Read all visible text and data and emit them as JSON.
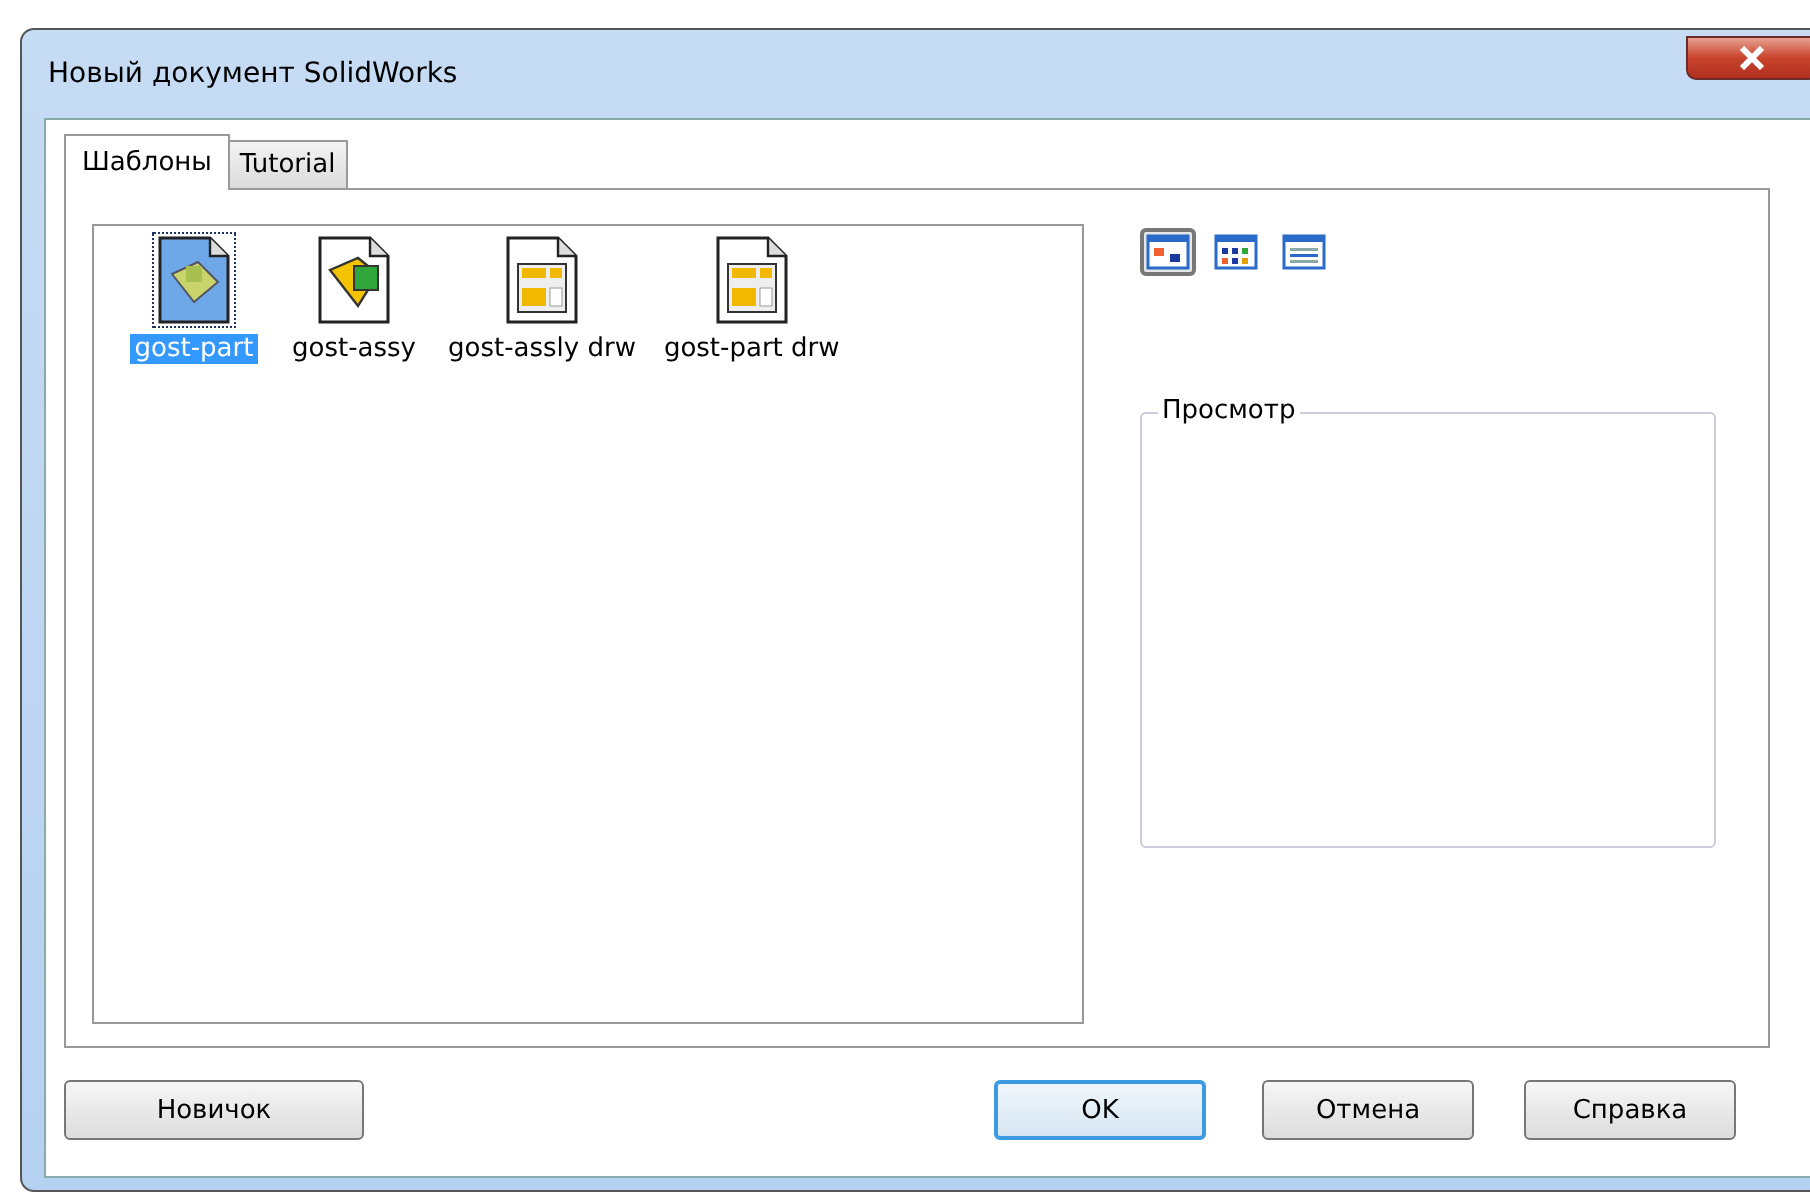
{
  "window": {
    "title": "Новый документ SolidWorks"
  },
  "tabs": [
    {
      "label": "Шаблоны",
      "selected": true
    },
    {
      "label": "Tutorial",
      "selected": false
    }
  ],
  "templates": [
    {
      "name": "gost-part",
      "kind": "part",
      "selected": true
    },
    {
      "name": "gost-assy",
      "kind": "assembly",
      "selected": false
    },
    {
      "name": "gost-assly drw",
      "kind": "drawing",
      "selected": false
    },
    {
      "name": "gost-part drw",
      "kind": "drawing",
      "selected": false
    }
  ],
  "view_modes": [
    {
      "kind": "large",
      "selected": true
    },
    {
      "kind": "list",
      "selected": false
    },
    {
      "kind": "details",
      "selected": false
    }
  ],
  "preview": {
    "label": "Просмотр"
  },
  "buttons": [
    {
      "label": "Новичок",
      "default": false
    },
    {
      "label": "OK",
      "default": true
    },
    {
      "label": "Отмена",
      "default": false
    },
    {
      "label": "Справка",
      "default": false
    }
  ]
}
